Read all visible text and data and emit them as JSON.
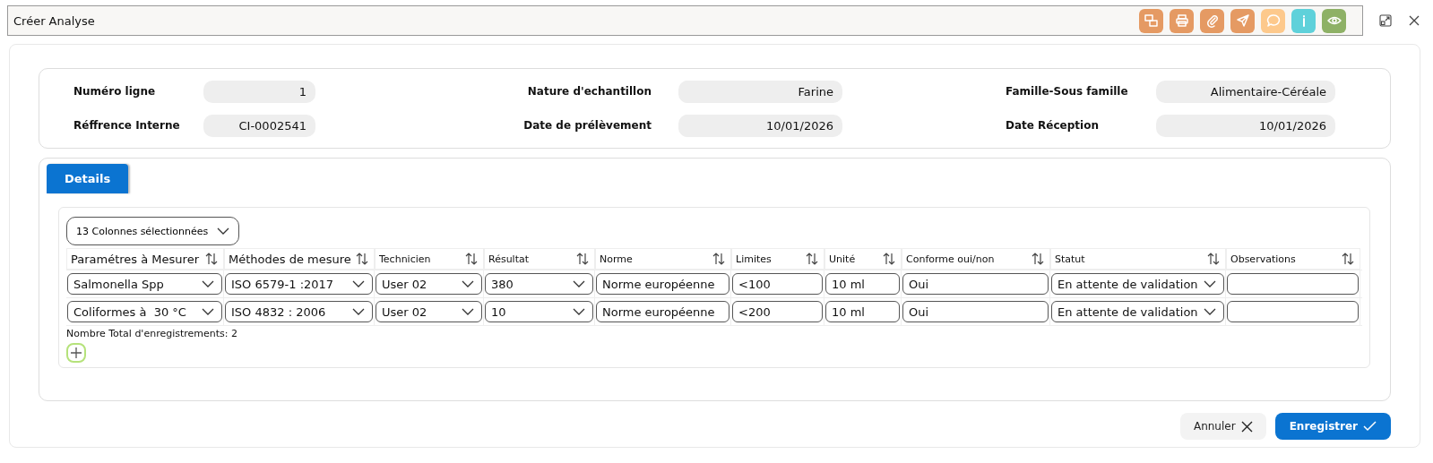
{
  "window": {
    "title": "Créer Analyse"
  },
  "toolbar": [
    {
      "kind": "copies",
      "color": "#e59a63"
    },
    {
      "kind": "print",
      "color": "#e59a63"
    },
    {
      "kind": "attach",
      "color": "#e59a63"
    },
    {
      "kind": "send",
      "color": "#e59a63"
    },
    {
      "kind": "comment",
      "color": "#fdc98c"
    },
    {
      "kind": "info",
      "color": "#5fd1da"
    },
    {
      "kind": "view",
      "color": "#8eb166"
    }
  ],
  "header_fields": [
    {
      "label": "Numéro ligne",
      "value": "1"
    },
    {
      "label": "Nature d'echantillon",
      "value": "Farine"
    },
    {
      "label": "Famille-Sous famille",
      "value": "Alimentaire-Céréale"
    },
    {
      "label": "Réffrence Interne",
      "value": "CI-0002541"
    },
    {
      "label": "Date de prélèvement",
      "value": "10/01/2026"
    },
    {
      "label": "Date Réception",
      "value": "10/01/2026"
    }
  ],
  "tabs": [
    {
      "label": "Details",
      "selected": true
    }
  ],
  "column_picker": "13 Colonnes sélectionnées",
  "table": {
    "columns": [
      {
        "label": "Paramétres à Mesurer",
        "large": true
      },
      {
        "label": "Méthodes de mesure",
        "large": true
      },
      {
        "label": "Technicien",
        "large": false
      },
      {
        "label": "Résultat",
        "large": false
      },
      {
        "label": "Norme",
        "large": false
      },
      {
        "label": "Limites",
        "large": false
      },
      {
        "label": "Unité",
        "large": false
      },
      {
        "label": "Conforme oui/non",
        "large": false
      },
      {
        "label": "Statut",
        "large": false
      },
      {
        "label": "Observations",
        "large": false
      }
    ],
    "rows": [
      [
        {
          "kind": "select",
          "value": "Salmonella Spp"
        },
        {
          "kind": "select",
          "value": "ISO 6579-1 :2017"
        },
        {
          "kind": "select",
          "value": "User 02"
        },
        {
          "kind": "select",
          "value": "380"
        },
        {
          "kind": "input",
          "value": "Norme européenne"
        },
        {
          "kind": "input",
          "value": "<100"
        },
        {
          "kind": "input",
          "value": "10 ml"
        },
        {
          "kind": "input",
          "value": "Oui"
        },
        {
          "kind": "select",
          "value": "En attente de validation"
        },
        {
          "kind": "input"
        }
      ],
      [
        {
          "kind": "select",
          "value": "Coliformes à  30 °C"
        },
        {
          "kind": "select",
          "value": "ISO 4832 : 2006"
        },
        {
          "kind": "select",
          "value": "User 02"
        },
        {
          "kind": "select",
          "value": "10"
        },
        {
          "kind": "input",
          "value": "Norme européenne"
        },
        {
          "kind": "input",
          "value": "<200"
        },
        {
          "kind": "input",
          "value": "10 ml"
        },
        {
          "kind": "input",
          "value": "Oui"
        },
        {
          "kind": "select",
          "value": "En attente de validation"
        },
        {
          "kind": "input"
        }
      ]
    ],
    "footer": "Nombre Total d'enregistrements: 2"
  },
  "buttons": [
    {
      "label": "Annuler",
      "kind": "cancel"
    },
    {
      "label": "Enregistrer",
      "kind": "save"
    }
  ]
}
